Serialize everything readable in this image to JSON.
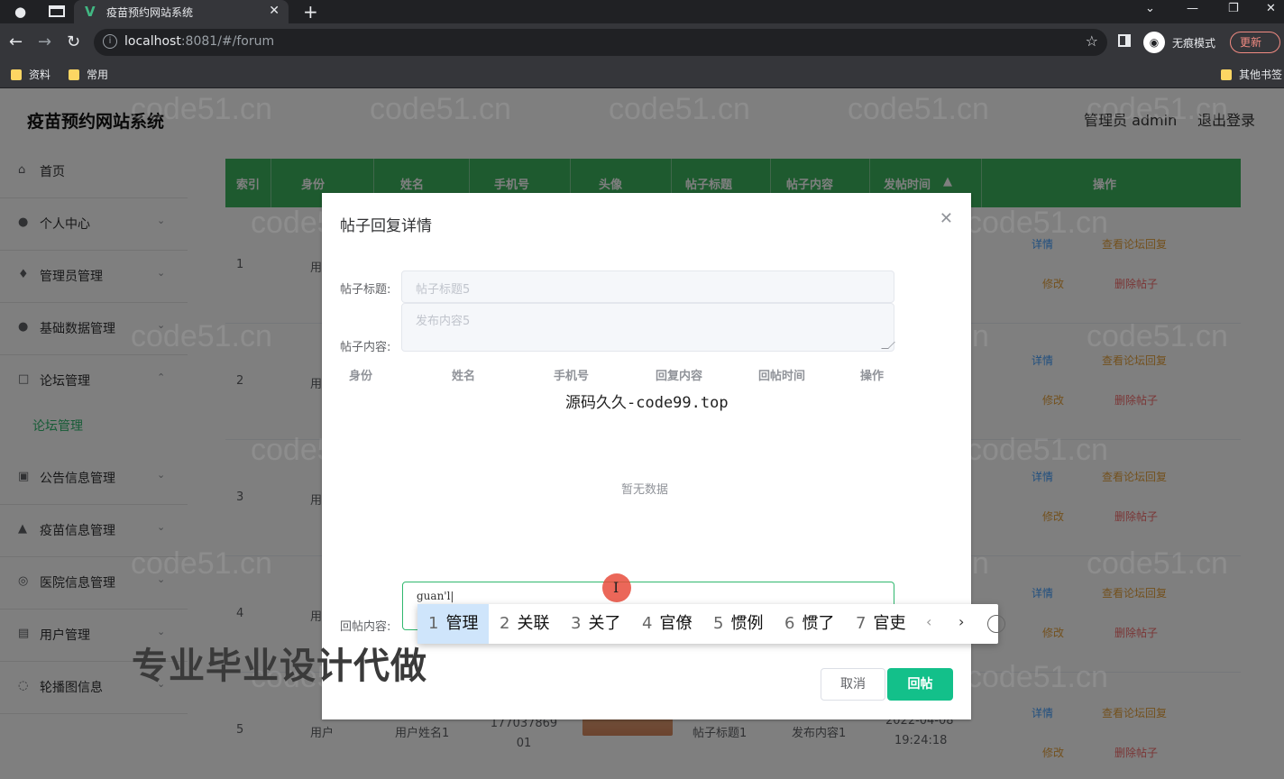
{
  "browser": {
    "tab_title": "疫苗预约网站系统",
    "url_host": "localhost",
    "url_path": ":8081/#/forum",
    "incognito_label": "无痕模式",
    "update_label": "更新",
    "bookmarks": [
      "资料",
      "常用"
    ],
    "other_bookmarks": "其他书签"
  },
  "app": {
    "title": "疫苗预约网站系统",
    "user": "管理员 admin",
    "logout": "退出登录"
  },
  "sidebar": {
    "items": [
      {
        "label": "首页",
        "icon": "home-icon"
      },
      {
        "label": "个人中心",
        "icon": "user-icon"
      },
      {
        "label": "管理员管理",
        "icon": "mic-icon"
      },
      {
        "label": "基础数据管理",
        "icon": "user-icon"
      },
      {
        "label": "论坛管理",
        "icon": "chat-icon"
      },
      {
        "label": "公告信息管理",
        "icon": "doc-icon"
      },
      {
        "label": "疫苗信息管理",
        "icon": "hat-icon"
      },
      {
        "label": "医院信息管理",
        "icon": "hospital-icon"
      },
      {
        "label": "用户管理",
        "icon": "user-icon"
      },
      {
        "label": "轮播图信息",
        "icon": "image-icon"
      }
    ],
    "sub_active": "论坛管理"
  },
  "table": {
    "headers": [
      "索引",
      "身份",
      "姓名",
      "手机号",
      "头像",
      "帖子标题",
      "帖子内容",
      "发帖时间",
      "操作"
    ],
    "rows": [
      {
        "index": "1",
        "role": "用"
      },
      {
        "index": "2",
        "role": "用"
      },
      {
        "index": "3",
        "role": "用"
      },
      {
        "index": "4",
        "role": "用"
      },
      {
        "index": "5",
        "role": "用户",
        "name": "用户姓名1",
        "phone": "17703786901",
        "title": "帖子标题1",
        "content": "发布内容1",
        "time_date": "2022-04-08",
        "time_clock": "19:24:18"
      }
    ],
    "actions": {
      "detail": "详情",
      "view_reply": "查看论坛回复",
      "edit": "修改",
      "delete": "删除帖子"
    }
  },
  "dialog": {
    "title": "帖子回复详情",
    "post_title_label": "帖子标题:",
    "post_title_value": "帖子标题5",
    "post_content_label": "帖子内容:",
    "post_content_value": "发布内容5",
    "reply_headers": [
      "身份",
      "姓名",
      "手机号",
      "回复内容",
      "回帖时间",
      "操作"
    ],
    "center_text": "源码久久-code99.top",
    "empty_text": "暂无数据",
    "reply_label": "回帖内容:",
    "reply_value": "guan'l|",
    "cancel": "取消",
    "submit": "回帖"
  },
  "ime": {
    "candidates": [
      {
        "num": "1",
        "text": "管理"
      },
      {
        "num": "2",
        "text": "关联"
      },
      {
        "num": "3",
        "text": "关了"
      },
      {
        "num": "4",
        "text": "官僚"
      },
      {
        "num": "5",
        "text": "惯例"
      },
      {
        "num": "6",
        "text": "惯了"
      },
      {
        "num": "7",
        "text": "官吏"
      }
    ]
  },
  "promo": "专业毕业设计代做",
  "watermark": "code51.cn"
}
